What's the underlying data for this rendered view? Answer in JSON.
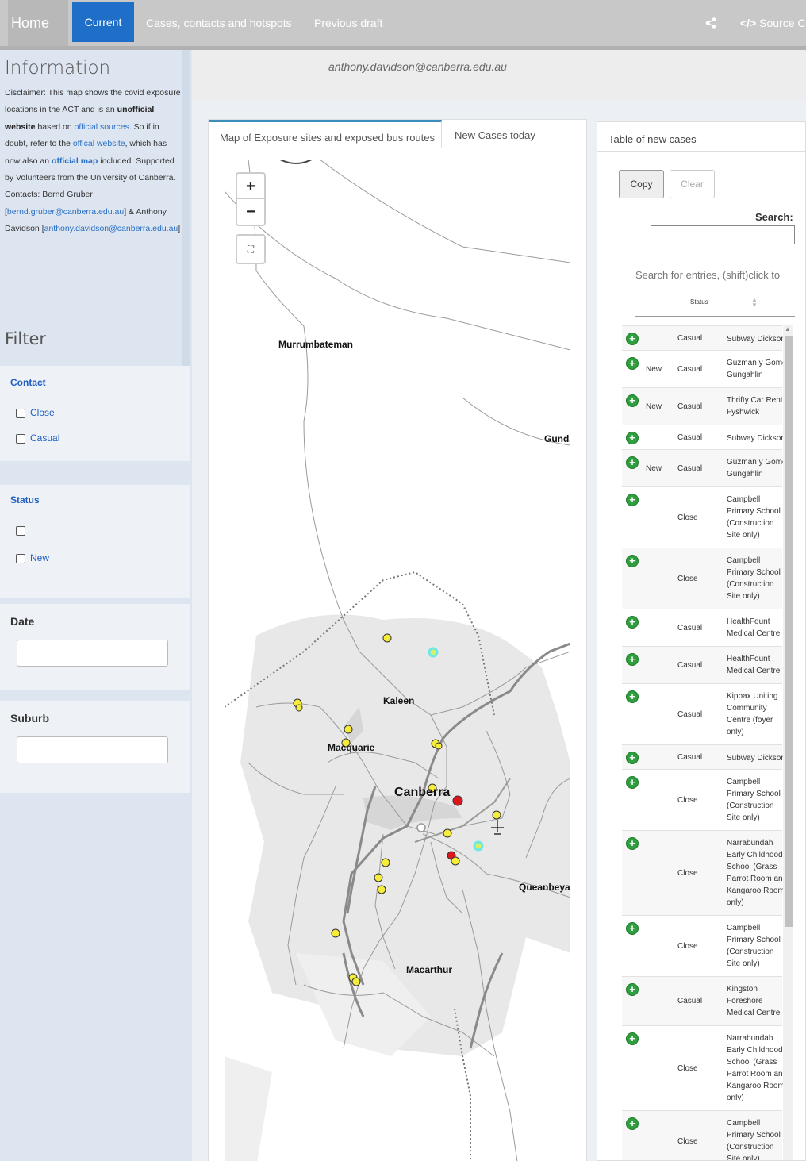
{
  "nav": {
    "home": "Home",
    "current": "Current",
    "cases": "Cases, contacts and hotspots",
    "draft": "Previous draft",
    "source": "Source Co"
  },
  "sidebar": {
    "info_title": "Information",
    "disclaimer_1": "Disclaimer: This map shows the covid exposure locations in the ACT and is an ",
    "disclaimer_bold_1": "unofficial website",
    "disclaimer_2": " based on ",
    "link_official_sources": "official sources",
    "disclaimer_3": ". So if in doubt, refer to the ",
    "link_official_website": "offical website",
    "disclaimer_4": ", which has now also an ",
    "link_official_map": "official map",
    "disclaimer_5": " included. Supported by Volunteers from the University of Canberra. Contacts: Bernd Gruber [",
    "email_bernd": "bernd.gruber@canberra.edu.au",
    "disclaimer_6": "] & Anthony Davidson [",
    "email_anthony": "anthony.davidson@canberra.edu.au",
    "disclaimer_7": "]",
    "filter_title": "Filter",
    "contact_label": "Contact",
    "contact_options": [
      "Close",
      "Casual"
    ],
    "status_label": "Status",
    "status_options": [
      "",
      "New"
    ],
    "date_label": "Date",
    "suburb_label": "Suburb"
  },
  "main": {
    "user_email": "anthony.davidson@canberra.edu.au",
    "tabs": [
      "Map of Exposure sites and exposed bus routes",
      "New Cases today"
    ],
    "zoom_in": "+",
    "zoom_out": "−",
    "map_labels": [
      "Murrumbateman",
      "Gunda",
      "Kaleen",
      "Macquarie",
      "Canberra",
      "Queanbeya",
      "Macarthur"
    ]
  },
  "table": {
    "title": "Table of new cases",
    "copy": "Copy",
    "clear": "Clear",
    "search_label": "Search:",
    "search_hint": "Search for entries, (shift)click to",
    "col_status": "Status",
    "rows": [
      {
        "status": "",
        "contact": "Casual",
        "place": [
          "Subway Dickson"
        ]
      },
      {
        "status": "New",
        "contact": "Casual",
        "place": [
          "Guzman y Gomez",
          "Gungahlin"
        ]
      },
      {
        "status": "New",
        "contact": "Casual",
        "place": [
          "Thrifty Car Rental",
          "Fyshwick"
        ]
      },
      {
        "status": "",
        "contact": "Casual",
        "place": [
          "Subway Dickson"
        ]
      },
      {
        "status": "New",
        "contact": "Casual",
        "place": [
          "Guzman y Gomez",
          "Gungahlin"
        ]
      },
      {
        "status": "",
        "contact": "Close",
        "place": [
          "Campbell",
          "Primary School",
          "(Construction",
          "Site only)"
        ]
      },
      {
        "status": "",
        "contact": "Close",
        "place": [
          "Campbell",
          "Primary School",
          "(Construction",
          "Site only)"
        ]
      },
      {
        "status": "",
        "contact": "Casual",
        "place": [
          "HealthFount",
          "Medical Centre"
        ]
      },
      {
        "status": "",
        "contact": "Casual",
        "place": [
          "HealthFount",
          "Medical Centre"
        ]
      },
      {
        "status": "",
        "contact": "Casual",
        "place": [
          "Kippax Uniting",
          "Community",
          "Centre (foyer",
          "only)"
        ]
      },
      {
        "status": "",
        "contact": "Casual",
        "place": [
          "Subway Dickson"
        ]
      },
      {
        "status": "",
        "contact": "Close",
        "place": [
          "Campbell",
          "Primary School",
          "(Construction",
          "Site only)"
        ]
      },
      {
        "status": "",
        "contact": "Close",
        "place": [
          "Narrabundah",
          "Early Childhood",
          "School (Grass",
          "Parrot Room and",
          "Kangaroo Room",
          "only)"
        ]
      },
      {
        "status": "",
        "contact": "Close",
        "place": [
          "Campbell",
          "Primary School",
          "(Construction",
          "Site only)"
        ]
      },
      {
        "status": "",
        "contact": "Casual",
        "place": [
          "Kingston",
          "Foreshore",
          "Medical Centre"
        ]
      },
      {
        "status": "",
        "contact": "Close",
        "place": [
          "Narrabundah",
          "Early Childhood",
          "School (Grass",
          "Parrot Room and",
          "Kangaroo Room",
          "only)"
        ]
      },
      {
        "status": "",
        "contact": "Close",
        "place": [
          "Campbell",
          "Primary School",
          "(Construction",
          "Site only)"
        ]
      }
    ]
  },
  "colors": {
    "nav_active": "#1f6fc9",
    "exposure_casual": "#f5ec3b",
    "exposure_close": "#e0151b",
    "exposure_new": "#6ee7e7",
    "add_row": "#2e9e3e"
  }
}
